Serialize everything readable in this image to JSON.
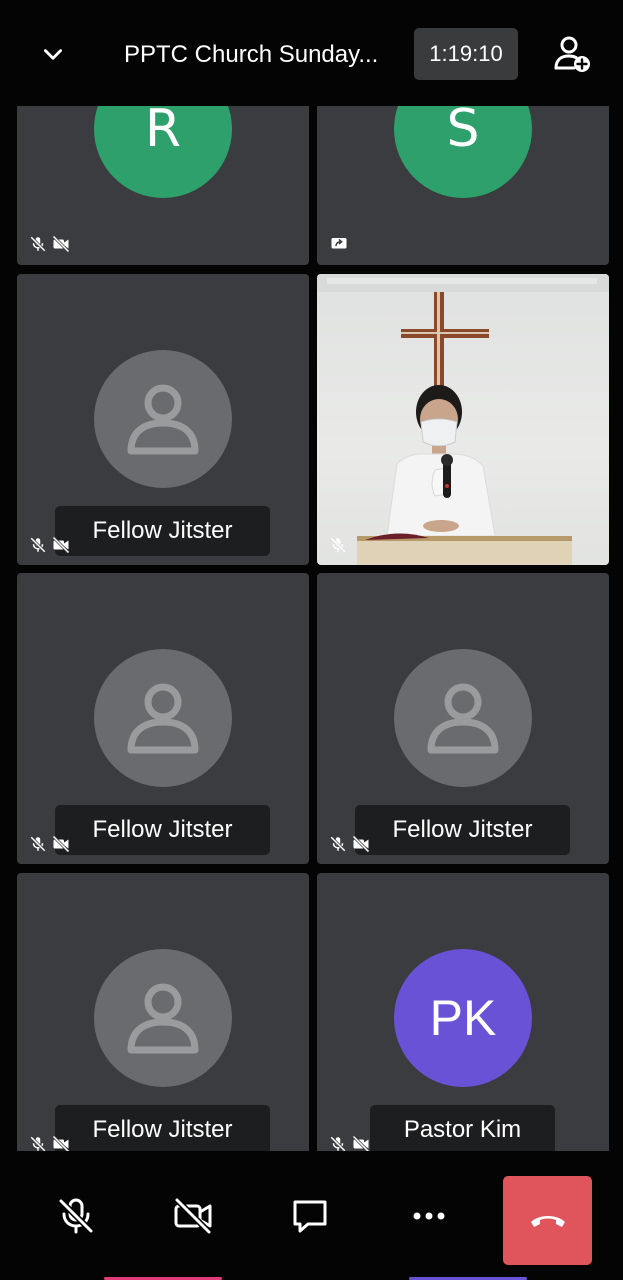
{
  "header": {
    "title": "PPTC Church Sunday...",
    "timer": "1:19:10"
  },
  "tiles": [
    {
      "avatar_letter": "R",
      "avatar_color": "#2ea06b",
      "status_icons": [
        "mic-off-icon",
        "camera-off-icon"
      ]
    },
    {
      "avatar_letter": "S",
      "avatar_color": "#2ea06b",
      "status_icons": [
        "screen-share-icon"
      ]
    },
    {
      "name": "Fellow Jitster",
      "avatar": "person-placeholder-icon",
      "status_icons": [
        "mic-off-icon",
        "camera-off-icon"
      ]
    },
    {
      "video": "speaker-video",
      "status_icons": [
        "mic-off-icon"
      ]
    },
    {
      "name": "Fellow Jitster",
      "avatar": "person-placeholder-icon",
      "status_icons": [
        "mic-off-icon",
        "camera-off-icon"
      ]
    },
    {
      "name": "Fellow Jitster",
      "avatar": "person-placeholder-icon",
      "status_icons": [
        "mic-off-icon",
        "camera-off-icon"
      ]
    },
    {
      "name": "Fellow Jitster",
      "avatar": "person-placeholder-icon",
      "status_icons": [
        "mic-off-icon",
        "camera-off-icon"
      ]
    },
    {
      "name": "Pastor Kim",
      "avatar_letter": "PK",
      "avatar_color": "#6a52d6",
      "status_icons": [
        "mic-off-icon",
        "camera-off-icon"
      ]
    }
  ],
  "toolbar": {
    "buttons": [
      "mic-off-icon",
      "camera-off-icon",
      "chat-icon",
      "more-icon",
      "hangup-icon"
    ],
    "hangup_color": "#e0545b"
  },
  "colors": {
    "background": "#040404",
    "tile": "#3b3c3f",
    "name_tag": "#1d1e20",
    "placeholder_avatar": "#6a6b6e"
  }
}
